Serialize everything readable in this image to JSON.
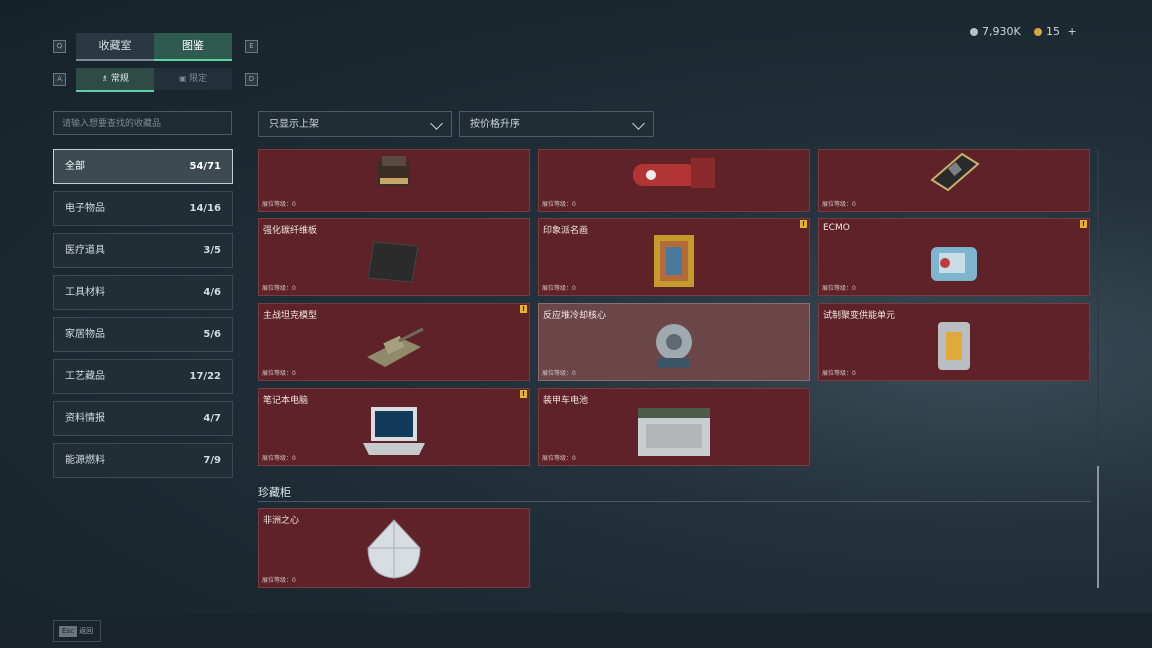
{
  "header": {
    "tabs": [
      {
        "label": "收藏室"
      },
      {
        "label": "图鉴"
      }
    ],
    "subtabs": [
      {
        "label": "常规"
      },
      {
        "label": "限定"
      }
    ],
    "keys": {
      "left_top": "Q",
      "right_top": "E",
      "left_sub": "A",
      "right_sub": "D"
    },
    "currency": {
      "silver": "7,930K",
      "gold": "15",
      "add": "+"
    }
  },
  "search": {
    "placeholder": "请输入想要查找的收藏品"
  },
  "filters": {
    "status": "只显示上架",
    "sort": "按价格升序"
  },
  "categories": [
    {
      "label": "全部",
      "count": "54/71"
    },
    {
      "label": "电子物品",
      "count": "14/16"
    },
    {
      "label": "医疗道具",
      "count": "3/5"
    },
    {
      "label": "工具材料",
      "count": "4/6"
    },
    {
      "label": "家居物品",
      "count": "5/6"
    },
    {
      "label": "工艺藏品",
      "count": "17/22"
    },
    {
      "label": "资料情报",
      "count": "4/7"
    },
    {
      "label": "能源燃料",
      "count": "7/9"
    }
  ],
  "items": [
    {
      "name": "",
      "level": "展位等级：0"
    },
    {
      "name": "",
      "level": "展位等级：0"
    },
    {
      "name": "",
      "level": "展位等级：0"
    },
    {
      "name": "强化碳纤维板",
      "level": "展位等级：0"
    },
    {
      "name": "印象派名画",
      "level": "展位等级：0",
      "warn": "!"
    },
    {
      "name": "ECMO",
      "level": "展位等级：0",
      "warn": "!"
    },
    {
      "name": "主战坦克模型",
      "level": "展位等级：0",
      "warn": "!"
    },
    {
      "name": "反应堆冷却核心",
      "level": "展位等级：0"
    },
    {
      "name": "试制聚变供能单元",
      "level": "展位等级：0"
    },
    {
      "name": "笔记本电脑",
      "level": "展位等级：0",
      "warn": "!"
    },
    {
      "name": "装甲车电池",
      "level": "展位等级：0"
    }
  ],
  "section": {
    "title": "珍藏柜"
  },
  "vault_items": [
    {
      "name": "非洲之心",
      "level": "展位等级：0"
    }
  ],
  "footer": {
    "esc_key": "Esc",
    "esc_label": "返回"
  },
  "colors": {
    "accent": "#5fd1a6",
    "card_bg": "#5e2228",
    "warning": "#e7b52a"
  }
}
